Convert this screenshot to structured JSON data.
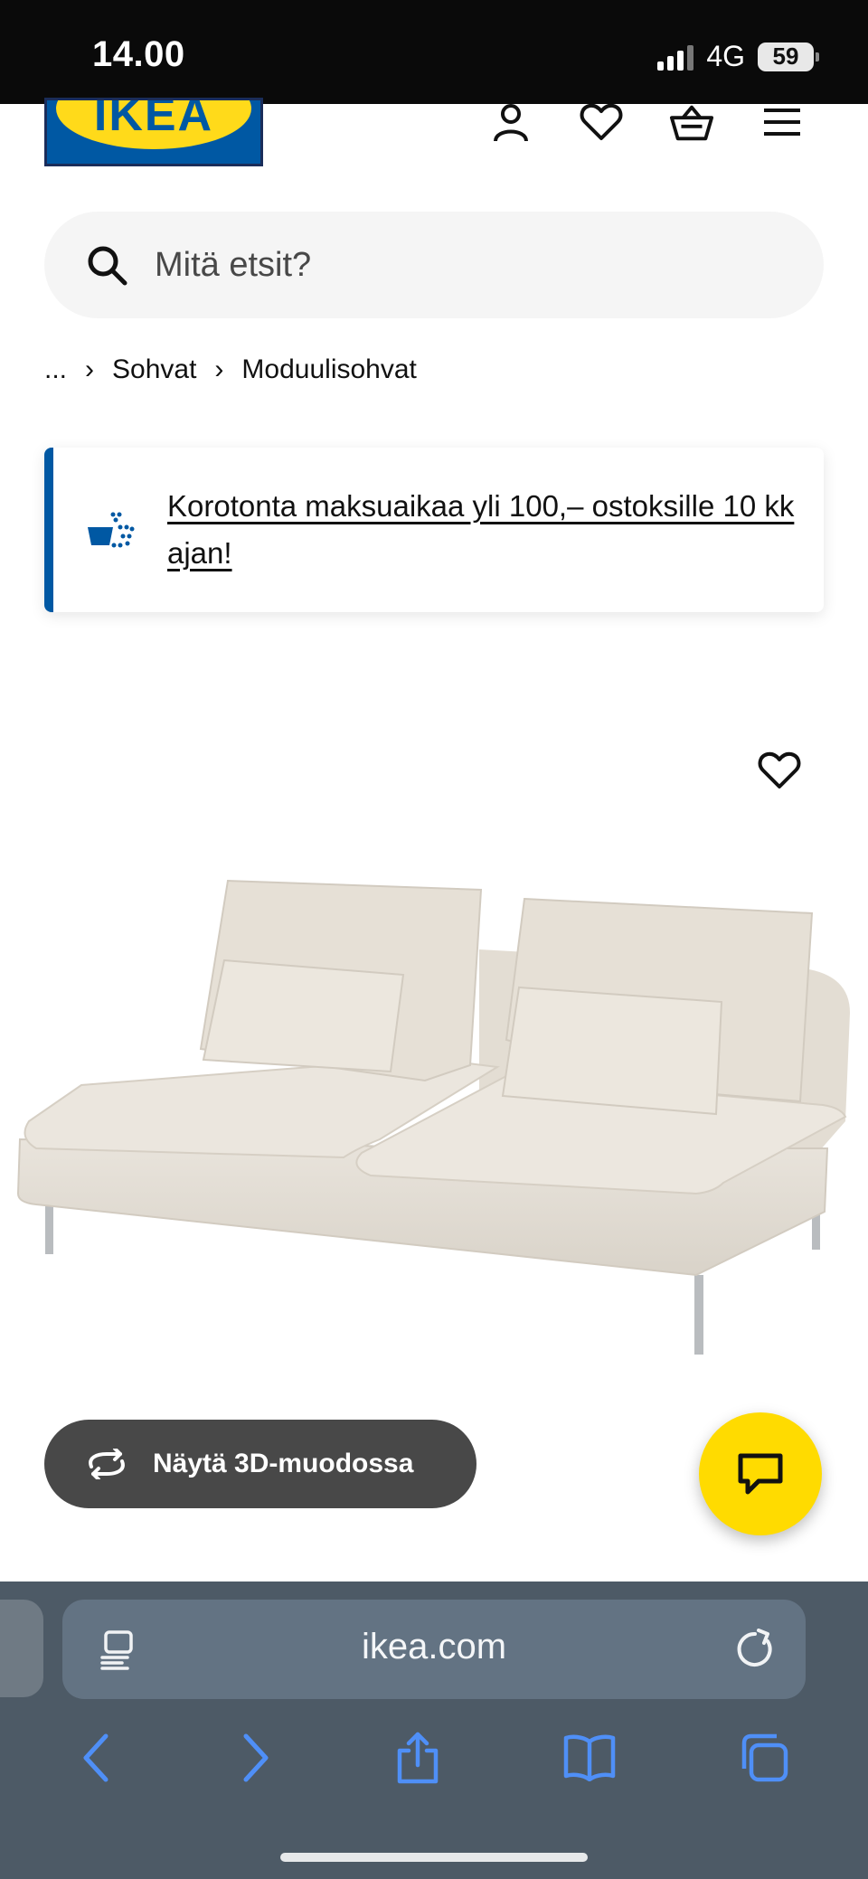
{
  "status_bar": {
    "time": "14.00",
    "network": "4G",
    "battery": "59"
  },
  "header": {
    "logo_text": "IKEA"
  },
  "search": {
    "placeholder": "Mitä etsit?"
  },
  "breadcrumb": {
    "ellipsis": "...",
    "items": [
      "Sohvat",
      "Moduulisohvat"
    ]
  },
  "banner": {
    "text": "Korotonta maksuaikaa yli 100,– ostoksille 10 kk ajan!"
  },
  "product": {
    "view_3d_label": "Näytä 3D-muodossa"
  },
  "browser": {
    "url": "ikea.com"
  },
  "colors": {
    "ikea_blue": "#0058a3",
    "ikea_yellow": "#ffdb00",
    "browser_bg": "#4d5a66",
    "accent_icon": "#4f8ff7"
  }
}
